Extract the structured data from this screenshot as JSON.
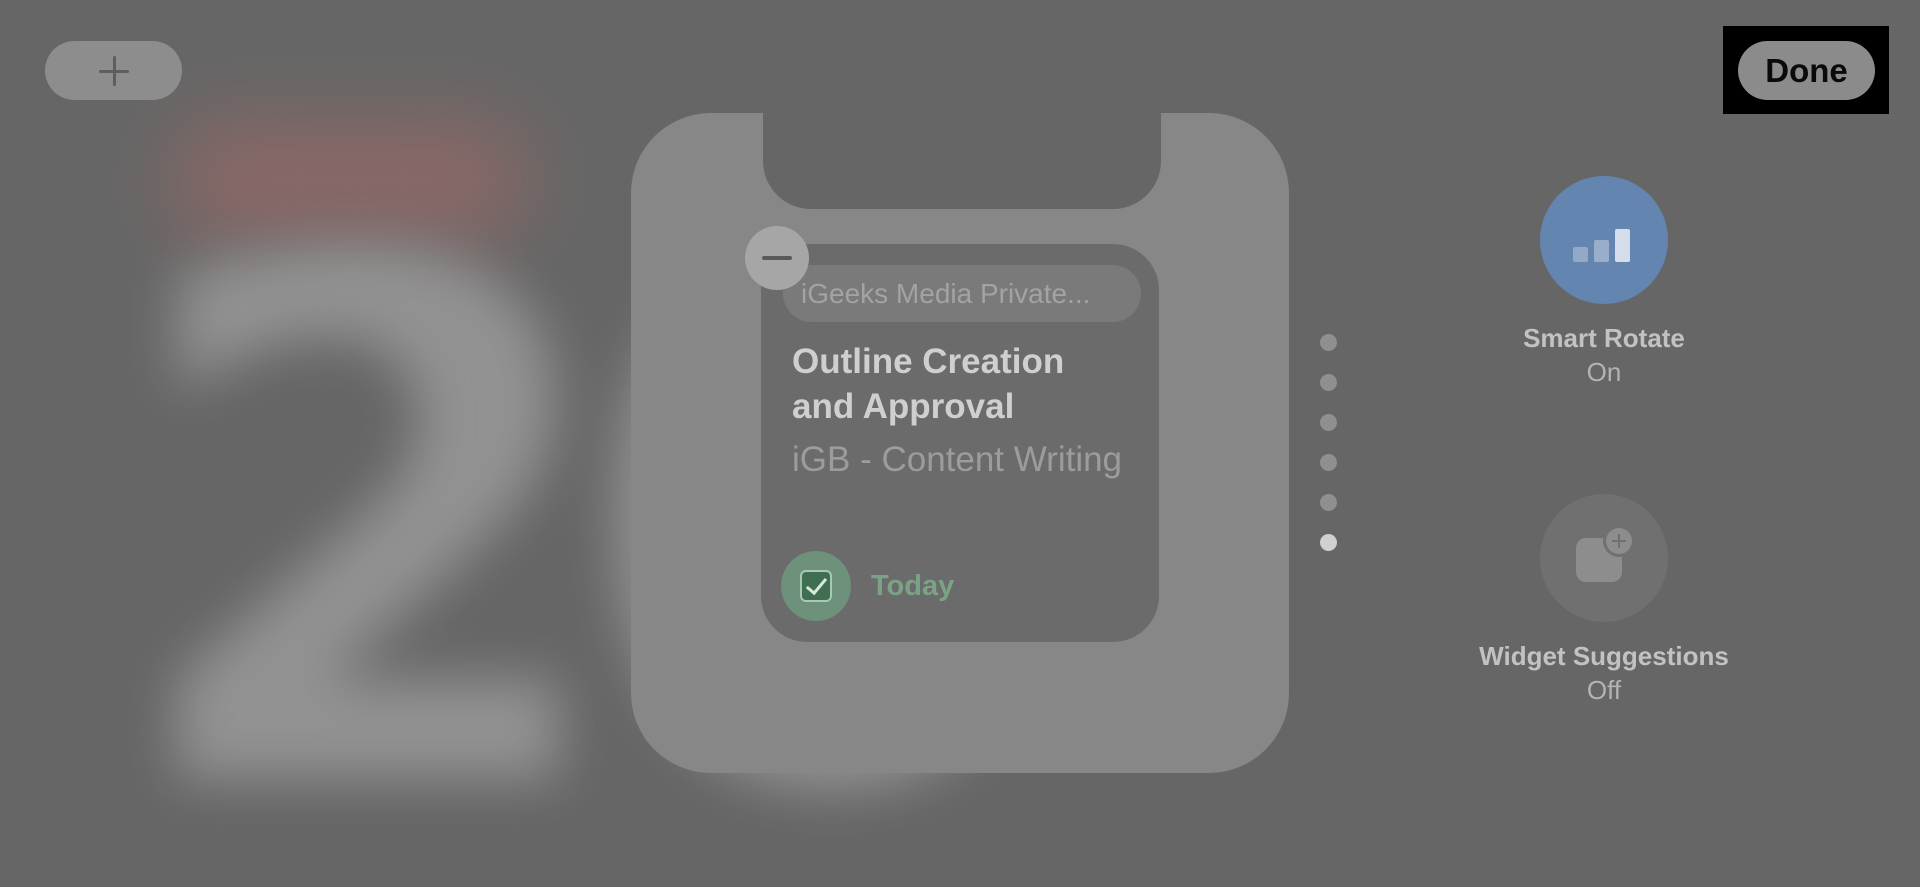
{
  "background": {
    "clock_digits": "20"
  },
  "toolbar": {
    "add_icon": "plus-icon",
    "done_label": "Done"
  },
  "widget": {
    "workspace": "iGeeks Media Private...",
    "task_title": "Outline Creation and Approval",
    "project": "iGB - Content Writing",
    "due": "Today",
    "check_icon": "checkbox-icon",
    "remove_icon": "minus-icon",
    "accent_color": "#6d917a"
  },
  "stack_pages": {
    "count": 6,
    "active_index": 5
  },
  "options": {
    "smart_rotate": {
      "title": "Smart Rotate",
      "status": "On",
      "icon": "bars-icon",
      "color": "#6385b0"
    },
    "widget_suggestions": {
      "title": "Widget Suggestions",
      "status": "Off",
      "icon": "widget-add-icon"
    }
  }
}
